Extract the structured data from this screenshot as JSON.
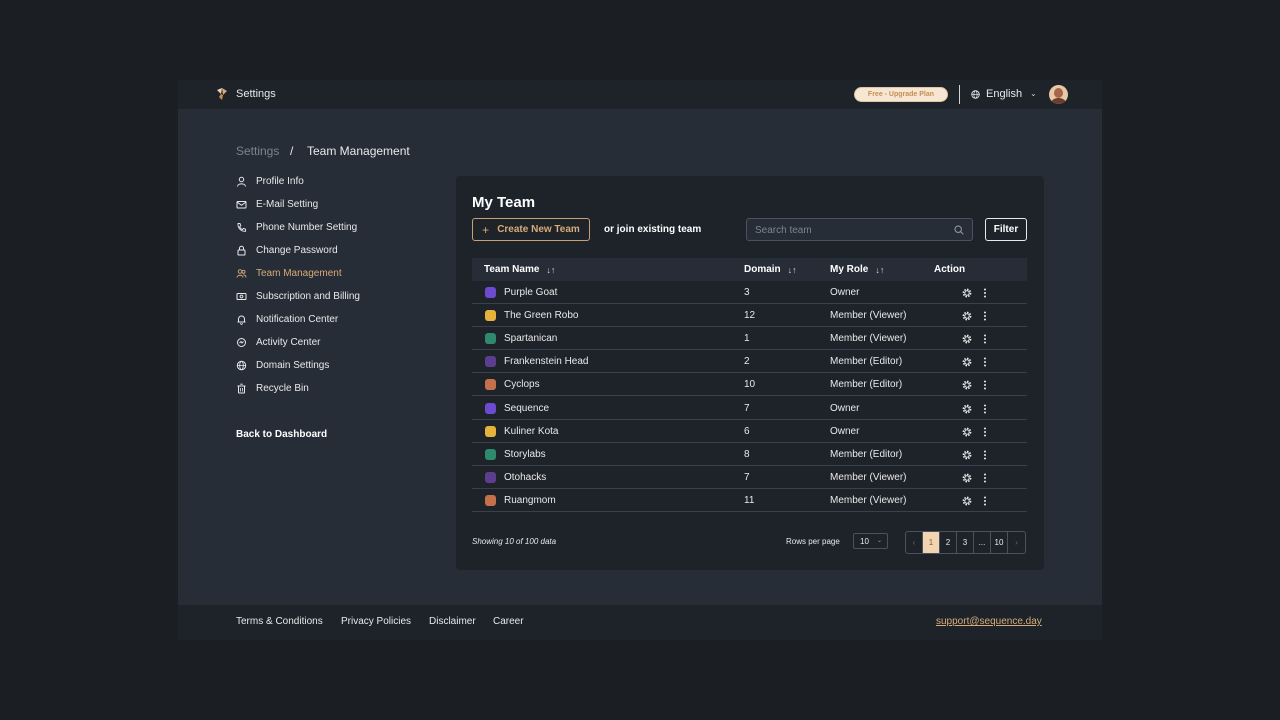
{
  "topbar": {
    "title": "Settings",
    "upgrade_label": "Free - Upgrade Plan",
    "language": "English"
  },
  "breadcrumb": {
    "parent": "Settings",
    "separator": "/",
    "current": "Team Management"
  },
  "sidebar": {
    "items": [
      {
        "label": "Profile Info",
        "icon": "user-icon"
      },
      {
        "label": "E-Mail Setting",
        "icon": "mail-icon"
      },
      {
        "label": "Phone Number Setting",
        "icon": "phone-icon"
      },
      {
        "label": "Change Password",
        "icon": "lock-icon"
      },
      {
        "label": "Team Management",
        "icon": "team-icon",
        "active": true
      },
      {
        "label": "Subscription and Billing",
        "icon": "billing-icon"
      },
      {
        "label": "Notification Center",
        "icon": "bell-icon"
      },
      {
        "label": "Activity Center",
        "icon": "activity-icon"
      },
      {
        "label": "Domain Settings",
        "icon": "globe-icon"
      },
      {
        "label": "Recycle Bin",
        "icon": "trash-icon"
      }
    ],
    "back_label": "Back to Dashboard"
  },
  "team": {
    "title": "My Team",
    "create_label": "Create New Team",
    "join_text": "or join existing team",
    "search_placeholder": "Search team",
    "filter_label": "Filter",
    "columns": [
      "Team Name",
      "Domain",
      "My Role",
      "Action"
    ],
    "rows": [
      {
        "name": "Purple Goat",
        "domain": "3",
        "role": "Owner",
        "color": "#6d4bd1"
      },
      {
        "name": "The Green Robo",
        "domain": "12",
        "role": "Member (Viewer)",
        "color": "#e5b23c"
      },
      {
        "name": "Spartanican",
        "domain": "1",
        "role": "Member (Viewer)",
        "color": "#2f8a6d"
      },
      {
        "name": "Frankenstein Head",
        "domain": "2",
        "role": "Member (Editor)",
        "color": "#5b3e8e"
      },
      {
        "name": "Cyclops",
        "domain": "10",
        "role": "Member (Editor)",
        "color": "#c4704a"
      },
      {
        "name": "Sequence",
        "domain": "7",
        "role": "Owner",
        "color": "#6d4bd1"
      },
      {
        "name": "Kuliner Kota",
        "domain": "6",
        "role": "Owner",
        "color": "#e5b23c"
      },
      {
        "name": "Storylabs",
        "domain": "8",
        "role": "Member (Editor)",
        "color": "#2f8a6d"
      },
      {
        "name": "Otohacks",
        "domain": "7",
        "role": "Member (Viewer)",
        "color": "#5b3e8e"
      },
      {
        "name": "Ruangmom",
        "domain": "11",
        "role": "Member (Viewer)",
        "color": "#c4704a"
      }
    ],
    "showing_text": "Showing 10 of 100 data",
    "rows_per_page_label": "Rows per page",
    "rows_per_page_value": "10",
    "pages": [
      "1",
      "2",
      "3",
      "...",
      "10"
    ],
    "current_page": "1"
  },
  "footer": {
    "links": [
      "Terms & Conditions",
      "Privacy Policies",
      "Disclaimer",
      "Career"
    ],
    "support_email": "support@sequence.day"
  }
}
